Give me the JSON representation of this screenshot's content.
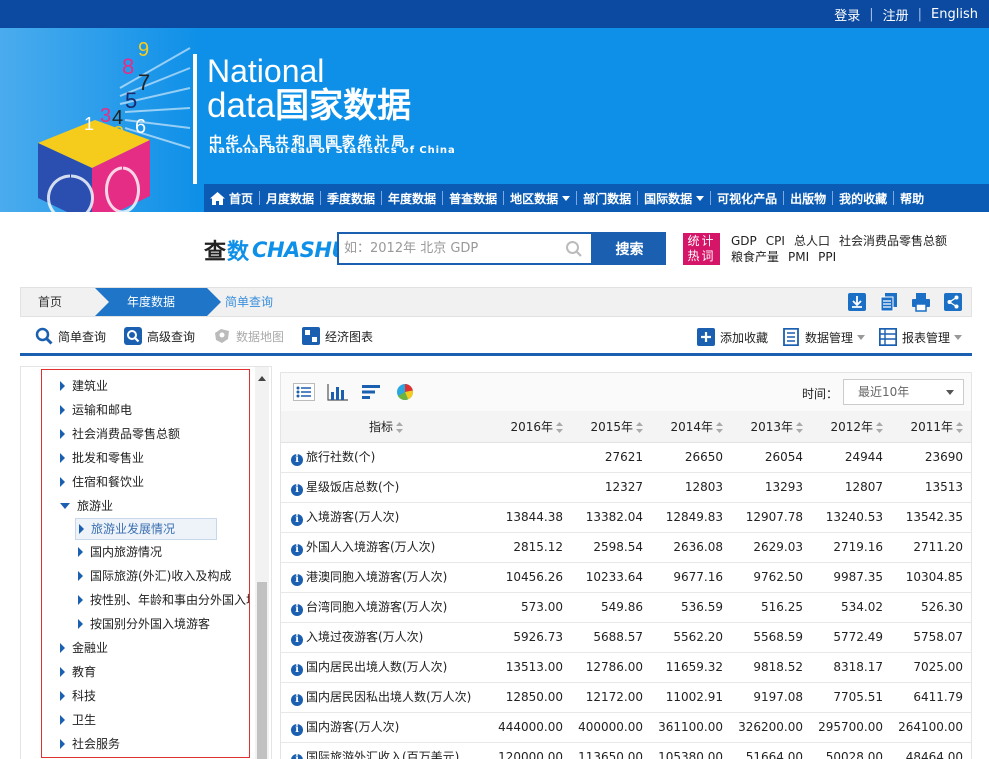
{
  "toplinks": {
    "login": "登录",
    "register": "注册",
    "english": "English"
  },
  "brand": {
    "en1": "National",
    "en2_prefix": "data",
    "cn_title": "国家数据",
    "cn_sub": "中华人民共和国国家统计局",
    "en_sub": "National Bureau of Statistics of China",
    "cube_digits": [
      "1",
      "2",
      "3",
      "4",
      "5",
      "6",
      "7",
      "8",
      "9"
    ]
  },
  "nav": {
    "items": [
      {
        "label": "首页",
        "icon": "home-icon"
      },
      {
        "label": "月度数据"
      },
      {
        "label": "季度数据"
      },
      {
        "label": "年度数据"
      },
      {
        "label": "普查数据"
      },
      {
        "label": "地区数据",
        "dropdown": true
      },
      {
        "label": "部门数据"
      },
      {
        "label": "国际数据",
        "dropdown": true
      },
      {
        "label": "可视化产品"
      },
      {
        "label": "出版物"
      },
      {
        "label": "我的收藏"
      },
      {
        "label": "帮助"
      }
    ]
  },
  "search": {
    "logo_cn_1": "查",
    "logo_cn_2": "数",
    "logo_en": "CHASHU",
    "placeholder": "如：2012年 北京 GDP",
    "button": "搜索",
    "hot_label_1": "统计",
    "hot_label_2": "热词",
    "hot_words": [
      "GDP",
      "CPI",
      "总人口",
      "社会消费品零售总额",
      "粮食产量",
      "PMI",
      "PPI"
    ]
  },
  "breadcrumb": {
    "home": "首页",
    "active": "年度数据",
    "current": "简单查询"
  },
  "toolbar": {
    "simple": "简单查询",
    "advanced": "高级查询",
    "map": "数据地图",
    "chart": "经济图表",
    "favorite": "添加收藏",
    "data_mgmt": "数据管理",
    "report_mgmt": "报表管理"
  },
  "tree": {
    "nodes": [
      {
        "label": "建筑业",
        "level": 1
      },
      {
        "label": "运输和邮电",
        "level": 1
      },
      {
        "label": "社会消费品零售总额",
        "level": 1
      },
      {
        "label": "批发和零售业",
        "level": 1
      },
      {
        "label": "住宿和餐饮业",
        "level": 1
      },
      {
        "label": "旅游业",
        "level": 1,
        "expanded": true
      },
      {
        "label": "旅游业发展情况",
        "level": 2,
        "selected": true
      },
      {
        "label": "国内旅游情况",
        "level": 2
      },
      {
        "label": "国际旅游(外汇)收入及构成",
        "level": 2
      },
      {
        "label": "按性别、年龄和事由分外国入境游客",
        "level": 2
      },
      {
        "label": "按国别分外国入境游客",
        "level": 2
      },
      {
        "label": "金融业",
        "level": 1
      },
      {
        "label": "教育",
        "level": 1
      },
      {
        "label": "科技",
        "level": 1
      },
      {
        "label": "卫生",
        "level": 1
      },
      {
        "label": "社会服务",
        "level": 1
      }
    ]
  },
  "table": {
    "time_label": "时间：",
    "time_value": "最近10年",
    "indicator_header": "指标",
    "years": [
      "2016年",
      "2015年",
      "2014年",
      "2013年",
      "2012年",
      "2011年"
    ],
    "rows": [
      {
        "name": "旅行社数(个)",
        "values": [
          "",
          "27621",
          "26650",
          "26054",
          "24944",
          "23690"
        ]
      },
      {
        "name": "星级饭店总数(个)",
        "values": [
          "",
          "12327",
          "12803",
          "13293",
          "12807",
          "13513"
        ]
      },
      {
        "name": "入境游客(万人次)",
        "values": [
          "13844.38",
          "13382.04",
          "12849.83",
          "12907.78",
          "13240.53",
          "13542.35"
        ]
      },
      {
        "name": "外国人入境游客(万人次)",
        "values": [
          "2815.12",
          "2598.54",
          "2636.08",
          "2629.03",
          "2719.16",
          "2711.20"
        ]
      },
      {
        "name": "港澳同胞入境游客(万人次)",
        "values": [
          "10456.26",
          "10233.64",
          "9677.16",
          "9762.50",
          "9987.35",
          "10304.85"
        ]
      },
      {
        "name": "台湾同胞入境游客(万人次)",
        "values": [
          "573.00",
          "549.86",
          "536.59",
          "516.25",
          "534.02",
          "526.30"
        ]
      },
      {
        "name": "入境过夜游客(万人次)",
        "values": [
          "5926.73",
          "5688.57",
          "5562.20",
          "5568.59",
          "5772.49",
          "5758.07"
        ]
      },
      {
        "name": "国内居民出境人数(万人次)",
        "values": [
          "13513.00",
          "12786.00",
          "11659.32",
          "9818.52",
          "8318.17",
          "7025.00"
        ]
      },
      {
        "name": "国内居民因私出境人数(万人次)",
        "values": [
          "12850.00",
          "12172.00",
          "11002.91",
          "9197.08",
          "7705.51",
          "6411.79"
        ]
      },
      {
        "name": "国内游客(万人次)",
        "values": [
          "444000.00",
          "400000.00",
          "361100.00",
          "326200.00",
          "295700.00",
          "264100.00"
        ]
      },
      {
        "name": "国际旅游外汇收入(百万美元)",
        "values": [
          "120000.00",
          "113650.00",
          "105380.00",
          "51664.00",
          "50028.00",
          "48464.00"
        ]
      }
    ]
  },
  "colors": {
    "brand_blue": "#0e90e8",
    "nav_blue": "#0b5bb4",
    "accent_blue": "#1b5fb1",
    "hot_pink": "#d51568",
    "tree_border_red": "#e13030"
  }
}
